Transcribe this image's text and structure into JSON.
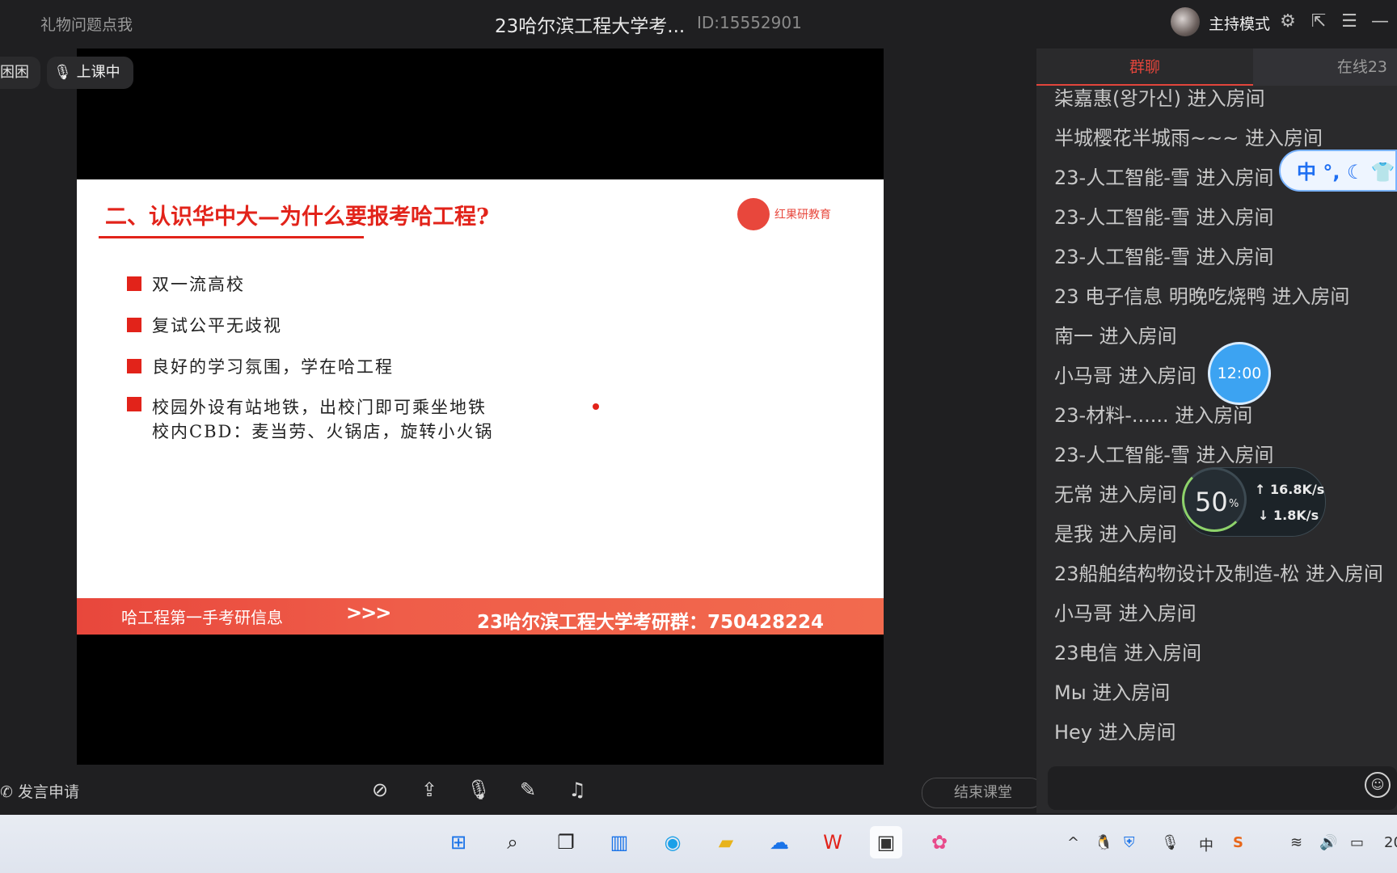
{
  "topbar": {
    "gift_label": "礼物问题点我",
    "title": "23哈尔滨工程大学考...",
    "room_id": "ID:15552901",
    "host_mode": "主持模式"
  },
  "chips": {
    "user": "困困",
    "status": "上课中"
  },
  "slide": {
    "title": "二、认识华中大—为什么要报考哈工程?",
    "logo_text": "红果研教育",
    "bullets": [
      "双一流高校",
      "复试公平无歧视",
      "良好的学习氛围，学在哈工程",
      "校园外设有站地铁，出校门即可乘坐地铁"
    ],
    "bullet_extra": "校内CBD：麦当劳、火锅店，旋转小火锅",
    "banner_left": "哈工程第一手考研信息",
    "banner_arrows": ">>>",
    "banner_right": "23哈尔滨工程大学考研群：750428224"
  },
  "controls": {
    "speak_request": "发言申请",
    "end_class": "结束课堂"
  },
  "panel": {
    "tab_group": "群聊",
    "tab_online": "在线23",
    "messages": [
      "柒嘉惠(왕가신) 进入房间",
      "半城樱花半城雨~~~ 进入房间",
      "23-人工智能-雪 进入房间",
      "23-人工智能-雪 进入房间",
      "23-人工智能-雪 进入房间",
      "23 电子信息 明晚吃烧鸭 进入房间",
      "南一 进入房间",
      "小马哥 进入房间",
      "23-材料-...... 进入房间",
      "23-人工智能-雪 进入房间",
      "无常 进入房间",
      "是我 进入房间",
      "23船舶结构物设计及制造-松 进入房间",
      "小马哥 进入房间",
      "23电信 进入房间",
      "Мы 进入房间",
      "Hey 进入房间"
    ]
  },
  "overlays": {
    "ime_label": "中",
    "clock": "12:00",
    "speed_percent": "50",
    "speed_percent_sym": "%",
    "upload": "↑ 16.8K/s",
    "download": "↓ 1.8K/s"
  },
  "taskbar": {
    "tray_ime": "中",
    "clock_partial": "20"
  }
}
